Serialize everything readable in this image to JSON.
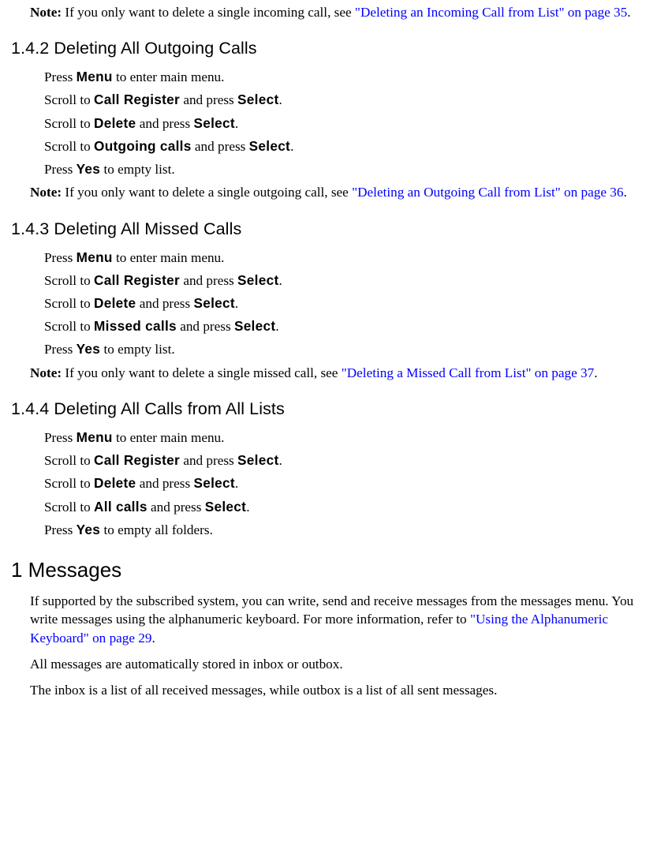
{
  "note1": {
    "label": "Note:",
    "pre": " If you only want to delete a single incoming call, see ",
    "link": "\"Deleting an Incoming Call from List\" on page 35",
    "post": "."
  },
  "s142": {
    "heading": "1.4.2  Deleting All Outgoing Calls",
    "steps": {
      "s1": {
        "a": "Press ",
        "b": "Menu",
        "c": " to enter main menu."
      },
      "s2": {
        "a": "Scroll to ",
        "b": "Call Register",
        "c": " and press ",
        "d": "Select",
        "e": "."
      },
      "s3": {
        "a": "Scroll to ",
        "b": "Delete",
        "c": " and press ",
        "d": "Select",
        "e": "."
      },
      "s4": {
        "a": "Scroll to ",
        "b": "Outgoing calls",
        "c": " and press ",
        "d": "Select",
        "e": "."
      },
      "s5": {
        "a": "Press ",
        "b": "Yes",
        "c": " to empty list."
      }
    },
    "note": {
      "label": "Note:",
      "pre": " If you only want to delete a single outgoing call, see ",
      "link": "\"Deleting an Outgoing Call from List\" on page 36",
      "post": "."
    }
  },
  "s143": {
    "heading": "1.4.3  Deleting All Missed Calls",
    "steps": {
      "s1": {
        "a": "Press ",
        "b": "Menu",
        "c": " to enter main menu."
      },
      "s2": {
        "a": "Scroll to ",
        "b": "Call Register",
        "c": " and press ",
        "d": "Select",
        "e": "."
      },
      "s3": {
        "a": "Scroll to ",
        "b": "Delete",
        "c": " and press ",
        "d": "Select",
        "e": "."
      },
      "s4": {
        "a": "Scroll to ",
        "b": "Missed calls",
        "c": " and press ",
        "d": "Select",
        "e": "."
      },
      "s5": {
        "a": "Press ",
        "b": "Yes",
        "c": " to empty list."
      }
    },
    "note": {
      "label": "Note:",
      "pre": " If you only want to delete a single missed call, see ",
      "link": "\"Deleting a Missed Call from List\" on page 37",
      "post": "."
    }
  },
  "s144": {
    "heading": "1.4.4  Deleting All Calls from All Lists",
    "steps": {
      "s1": {
        "a": "Press ",
        "b": "Menu",
        "c": " to enter main menu."
      },
      "s2": {
        "a": "Scroll to ",
        "b": "Call Register",
        "c": " and press ",
        "d": "Select",
        "e": "."
      },
      "s3": {
        "a": "Scroll to ",
        "b": "Delete",
        "c": " and press ",
        "d": "Select",
        "e": "."
      },
      "s4": {
        "a": "Scroll to ",
        "b": "All calls",
        "c": " and press ",
        "d": "Select",
        "e": "."
      },
      "s5": {
        "a": "Press ",
        "b": "Yes",
        "c": " to empty all folders."
      }
    }
  },
  "messages": {
    "heading": "1 Messages",
    "p1a": "If supported by the subscribed system, you can write, send and receive messages from the messages menu. You write messages using the alphanumeric keyboard. For more information, refer to ",
    "p1link": "\"Using the Alphanumeric Keyboard\" on page 29",
    "p1b": ".",
    "p2": "All messages are automatically stored in inbox or outbox.",
    "p3": "The inbox is a list of all received messages, while outbox is a list of all sent messages."
  }
}
